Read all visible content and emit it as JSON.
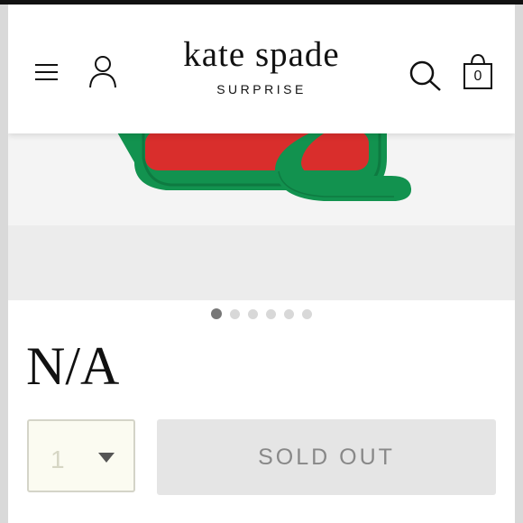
{
  "header": {
    "brand_name": "kate spade",
    "brand_sub": "SURPRISE",
    "cart_count": "0",
    "icons": [
      "menu-icon",
      "account-icon",
      "search-icon",
      "shopping-bag-icon"
    ]
  },
  "gallery": {
    "total_slides": 6,
    "active_index": 0,
    "product_colors": {
      "body": "#d92e2c",
      "trim": "#12924f"
    }
  },
  "product": {
    "title": "N/A"
  },
  "purchase": {
    "quantity": "1",
    "button_label": "SOLD OUT"
  }
}
